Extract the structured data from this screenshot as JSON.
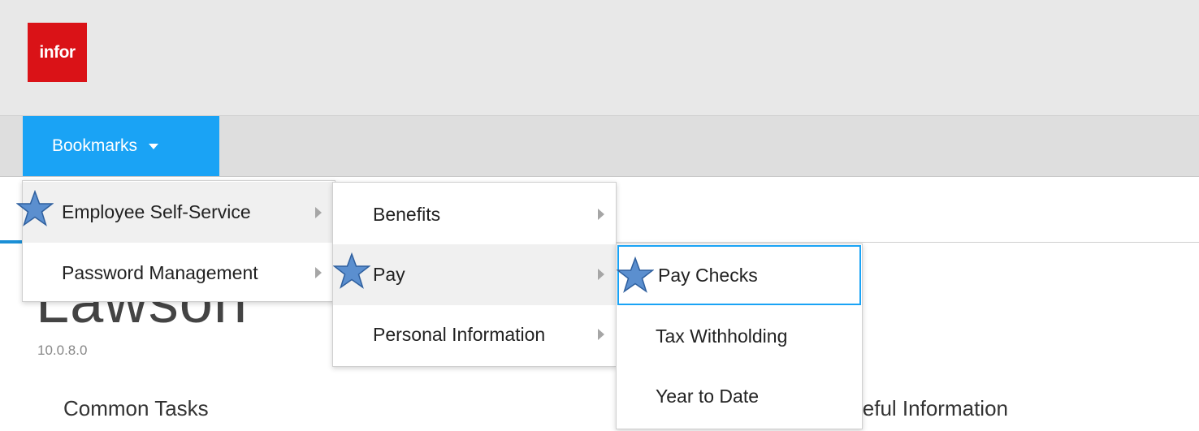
{
  "header": {
    "logo_text": "infor",
    "brand_color": "#da1217"
  },
  "navbar": {
    "bookmarks_label": "Bookmarks",
    "accent": "#1aa3f5"
  },
  "page": {
    "product_title": "Lawson",
    "version": "10.0.8.0",
    "common_tasks": "Common Tasks",
    "useful_information": "Useful Information"
  },
  "menus": {
    "level1": [
      {
        "label": "Employee Self-Service",
        "starred": true,
        "highlighted": true,
        "has_submenu": true
      },
      {
        "label": "Password Management",
        "starred": false,
        "highlighted": false,
        "has_submenu": true
      }
    ],
    "level2": [
      {
        "label": "Benefits",
        "starred": false,
        "highlighted": false,
        "has_submenu": true
      },
      {
        "label": "Pay",
        "starred": true,
        "highlighted": true,
        "has_submenu": true
      },
      {
        "label": "Personal Information",
        "starred": false,
        "highlighted": false,
        "has_submenu": true
      }
    ],
    "level3": [
      {
        "label": "Pay Checks",
        "starred": true,
        "focused": true
      },
      {
        "label": "Tax Withholding",
        "starred": false,
        "focused": false
      },
      {
        "label": "Year to Date",
        "starred": false,
        "focused": false
      }
    ]
  },
  "star_color": "#5b8fcf"
}
